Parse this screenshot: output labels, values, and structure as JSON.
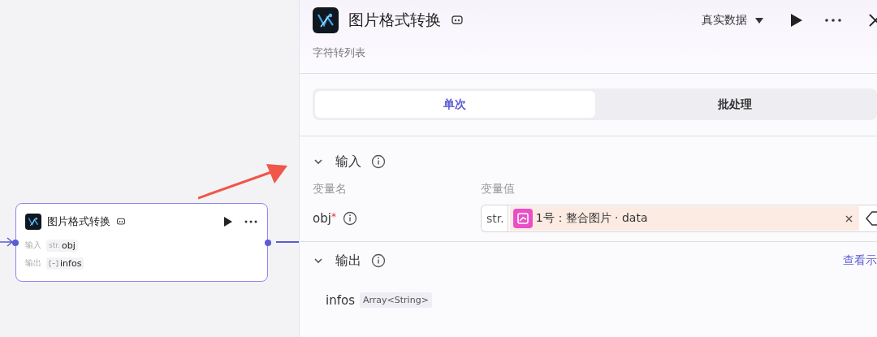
{
  "canvas": {
    "node": {
      "title": "图片格式转换",
      "rows": [
        {
          "label": "输入",
          "kind": "string",
          "type": "str.",
          "name": "obj"
        },
        {
          "label": "输出",
          "kind": "array",
          "name": "infos"
        }
      ]
    }
  },
  "panel": {
    "title": "图片格式转换",
    "run_mode": "真实数据",
    "subtitle": "字符转列表",
    "tabs": [
      {
        "label": "单次",
        "selected": true
      },
      {
        "label": "批处理",
        "selected": false
      }
    ],
    "input": {
      "title": "输入",
      "expanded": true,
      "columns": [
        "变量名",
        "变量值"
      ],
      "params": [
        {
          "name": "obj",
          "required": true,
          "required_mark": "*",
          "type": "str.",
          "ref": "1号：整合图片 · data"
        }
      ]
    },
    "output": {
      "title": "输出",
      "expanded": true,
      "link": "查看示",
      "params": [
        {
          "name": "infos",
          "type": "Array<String>"
        }
      ]
    }
  }
}
